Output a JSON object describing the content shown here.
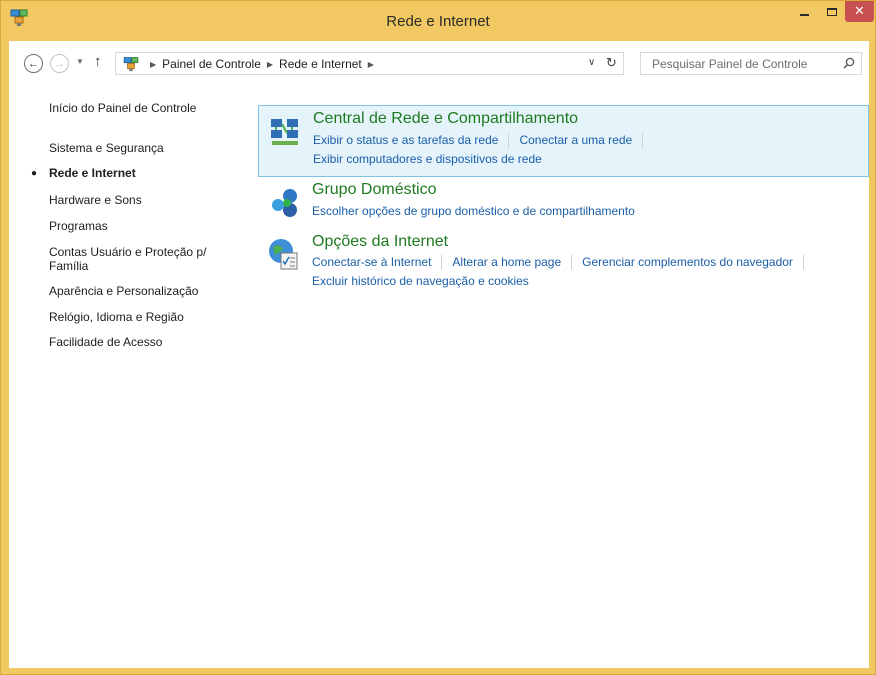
{
  "window": {
    "title": "Rede e Internet",
    "close_glyph": "✕"
  },
  "nav": {
    "back_glyph": "←",
    "forward_glyph": "→",
    "recent_glyph": "▼",
    "up_glyph": "↑",
    "breadcrumbs": [
      "Painel de Controle",
      "Rede e Internet"
    ],
    "crumb_separator": "▶",
    "dropdown_glyph": "∨",
    "refresh_glyph": "↻",
    "search_placeholder": "Pesquisar Painel de Controle"
  },
  "sidebar": {
    "items": [
      {
        "label": "Início do Painel de Controle",
        "active": false
      },
      {
        "label": "Sistema e Segurança",
        "active": false
      },
      {
        "label": "Rede e Internet",
        "active": true
      },
      {
        "label": "Hardware e Sons",
        "active": false
      },
      {
        "label": "Programas",
        "active": false
      },
      {
        "label": "Contas Usuário e Proteção p/ Família",
        "active": false
      },
      {
        "label": "Aparência e Personalização",
        "active": false
      },
      {
        "label": "Relógio, Idioma e Região",
        "active": false
      },
      {
        "label": "Facilidade de Acesso",
        "active": false
      }
    ],
    "bullet": "●"
  },
  "categories": [
    {
      "title": "Central de Rede e Compartilhamento",
      "icon": "network-center-icon",
      "links_row1": [
        "Exibir o status e as tarefas da rede",
        "Conectar a uma rede"
      ],
      "links_row2": [
        "Exibir computadores e dispositivos de rede"
      ]
    },
    {
      "title": "Grupo Doméstico",
      "icon": "homegroup-icon",
      "links_row1": [
        "Escolher opções de grupo doméstico e de compartilhamento"
      ]
    },
    {
      "title": "Opções da Internet",
      "icon": "internet-options-icon",
      "links_row1": [
        "Conectar-se à Internet",
        "Alterar a home page",
        "Gerenciar complementos do navegador"
      ],
      "links_row2": [
        "Excluir histórico de navegação e cookies"
      ]
    }
  ],
  "colors": {
    "titlebar": "#f1c862",
    "close_button": "#c75050",
    "category_title": "#1f7a1f",
    "link": "#1a5ea8",
    "highlight_bg": "#e5f3fb",
    "highlight_border": "#7fc4e8"
  }
}
